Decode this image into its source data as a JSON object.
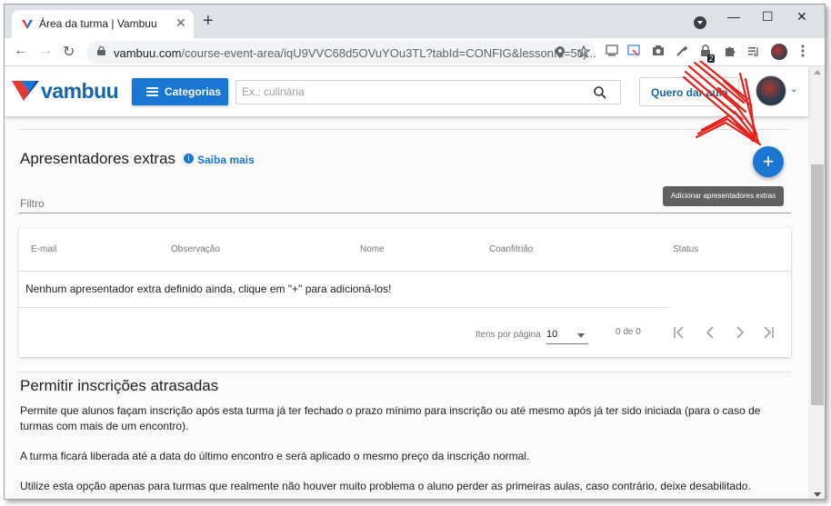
{
  "browser": {
    "tab_title": "Área da turma | Vambuu",
    "tab_close": "✕",
    "new_tab": "+",
    "url_host": "vambuu.com",
    "url_path": "/course-event-area/iqU9VVC68d5OVuYOu3TL?tabId=CONFIG&lessonId=5uj...",
    "extension_badge": "2",
    "window_controls": {
      "minimize": "—",
      "maximize": "☐",
      "close": "✕"
    },
    "nav": {
      "back": "←",
      "forward": "→",
      "reload": "↻"
    }
  },
  "site": {
    "logo_text": "vambuu",
    "categorias_label": "Categorias",
    "search_placeholder": "Ex.: culinária",
    "quero_label": "Quero dar aula",
    "user_chevron": "⌄"
  },
  "extras": {
    "title": "Apresentadores extras",
    "info": "i",
    "saiba_mais": "Saiba mais",
    "add_label": "+",
    "tooltip": "Adicionar apresentadores extras",
    "filter_label": "Filtro",
    "columns": [
      "E-mail",
      "Observação",
      "Nome",
      "Coanfitrião",
      "Status"
    ],
    "empty_message": "Nenhum apresentador extra definido ainda, clique em \"+\" para adicioná-los!",
    "pagination": {
      "items_per_page_label": "Itens por página",
      "items_per_page": "10",
      "range": "0 de 0",
      "first": "|<",
      "prev": "<",
      "next": ">",
      "last": ">|"
    }
  },
  "late": {
    "title": "Permitir inscrições atrasadas",
    "paragraphs": [
      "Permite que alunos façam inscrição após esta turma já ter fechado o prazo mínimo para inscrição ou até mesmo após já ter sido iniciada (para o caso de turmas com mais de um encontro).",
      "A turma ficará liberada até a data do último encontro e será aplicado o mesmo preço da inscrição normal.",
      "Utilize esta opção apenas para turmas que realmente não houver muito problema o aluno perder as primeiras aulas, caso contrário, deixe desabilitado."
    ]
  },
  "colors": {
    "primary": "#1976d2",
    "brand": "#1565a8",
    "annotation": "#e8201c"
  }
}
